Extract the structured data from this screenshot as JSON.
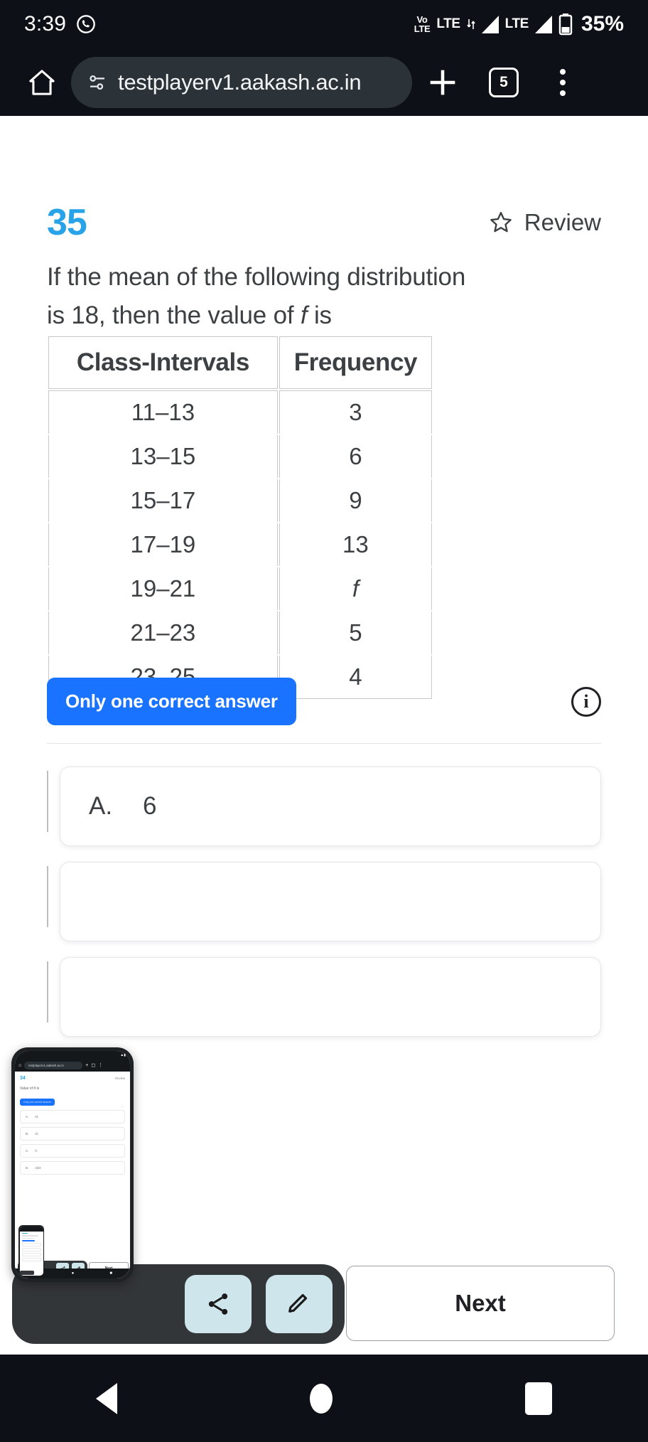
{
  "status_bar": {
    "time": "3:39",
    "call_icon": "call-forwarding-icon",
    "volte_line1": "Vo",
    "volte_line2": "LTE",
    "lte_label_1": "LTE",
    "lte_label_2": "LTE",
    "battery_percent": "35%"
  },
  "browser": {
    "home_icon": "home-icon",
    "site_info_icon": "site-settings-icon",
    "url": "testplayerv1.aakash.ac.in",
    "new_tab_icon": "plus-icon",
    "tab_count": "5",
    "menu_icon": "overflow-menu-icon"
  },
  "question": {
    "number": "35",
    "review_label": "Review",
    "review_icon": "star-outline-icon",
    "text_part1": "If the mean of the following distribution is 18, then the value of ",
    "text_italic": "f",
    "text_part2": " is"
  },
  "table": {
    "headers": [
      "Class-Intervals",
      "Frequency"
    ],
    "rows": [
      {
        "interval": "11–13",
        "frequency": "3",
        "italic": false
      },
      {
        "interval": "13–15",
        "frequency": "6",
        "italic": false
      },
      {
        "interval": "15–17",
        "frequency": "9",
        "italic": false
      },
      {
        "interval": "17–19",
        "frequency": "13",
        "italic": false
      },
      {
        "interval": "19–21",
        "frequency": "f",
        "italic": true
      },
      {
        "interval": "21–23",
        "frequency": "5",
        "italic": false
      },
      {
        "interval": "23–25",
        "frequency": "4",
        "italic": false
      }
    ]
  },
  "answer_meta": {
    "pill_label": "Only one correct answer",
    "info_icon": "info-circle-icon",
    "info_glyph": "i"
  },
  "options": [
    {
      "letter": "A.",
      "value": "6"
    },
    {
      "letter": "",
      "value": ""
    },
    {
      "letter": "",
      "value": ""
    }
  ],
  "dock": {
    "share_icon": "share-icon",
    "edit_icon": "pencil-edit-icon"
  },
  "next_button": {
    "label": "Next"
  },
  "mini_preview": {
    "question_number": "34",
    "review_label": "Review",
    "url": "testplayerv1.aakash.ac.in",
    "question_text": "Value of θ is",
    "pill_label": "Only one correct answer",
    "next_label": "Next",
    "options": [
      "A.",
      "B.",
      "C.",
      "D."
    ]
  },
  "nav_bar": {
    "back_icon": "triangle-back-icon",
    "home_icon": "circle-home-icon",
    "recents_icon": "square-recents-icon"
  },
  "colors": {
    "accent_blue": "#29a3e8",
    "pill_blue": "#1a73ff",
    "chrome_dark": "#0d1117",
    "text_gray": "#3c4043",
    "dock_gray": "#333639",
    "dock_btn": "#cfe5ec"
  }
}
